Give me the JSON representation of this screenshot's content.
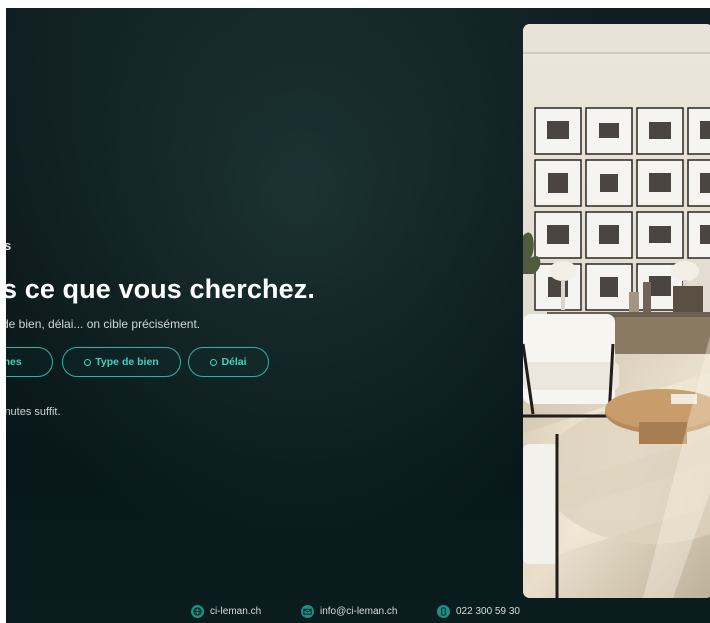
{
  "hero": {
    "eyebrow": "s",
    "headline": "s ce que vous cherchez.",
    "subhead": "de bien, délai... on cible précisément.",
    "footnote": "inutes suffit."
  },
  "chips": [
    {
      "label": "ones",
      "icon": ""
    },
    {
      "label": "Type de bien",
      "icon": "circle-dot-icon"
    },
    {
      "label": "Délai",
      "icon": "circle-dot-icon"
    }
  ],
  "footer": {
    "website": "ci-leman.ch",
    "email": "info@ci-leman.ch",
    "phone": "022 300 59 30"
  },
  "colors": {
    "accent": "#23b7a8",
    "background": "#0b1719"
  }
}
